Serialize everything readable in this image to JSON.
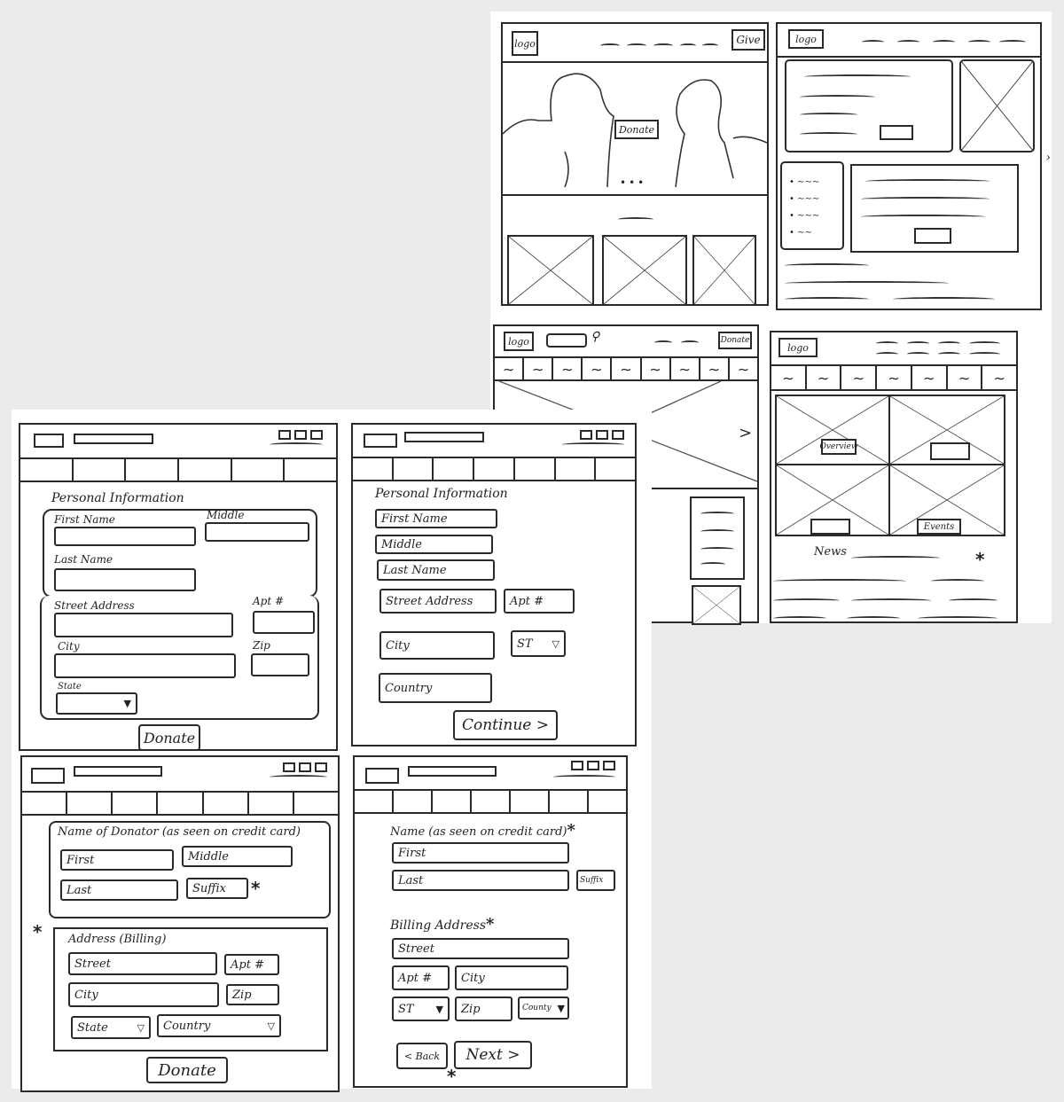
{
  "wireframes": {
    "home": {
      "logo": "logo",
      "give_button": "Give",
      "donate_button": "Donate",
      "carousel_dots": "•••"
    },
    "content_page": {
      "logo": "logo",
      "right_arrow": "›"
    },
    "search_page": {
      "logo": "logo",
      "search_icon": "⚲",
      "donate_button": "Donate",
      "next_arrow": ">"
    },
    "grid_page": {
      "logo": "logo",
      "tiles": [
        "Overview",
        "",
        "",
        "Events"
      ],
      "news_heading": "News",
      "asterisk": "*"
    },
    "form_a": {
      "section_title": "Personal Information",
      "labels": {
        "first": "First Name",
        "middle": "Middle",
        "last": "Last Name",
        "street": "Street Address",
        "apt": "Apt #",
        "city": "City",
        "zip": "Zip",
        "state": "State"
      },
      "state_dropdown_icon": "▼",
      "submit_button": "Donate"
    },
    "form_b": {
      "section_title": "Personal Information",
      "fields": {
        "first": "First Name",
        "middle": "Middle",
        "last": "Last Name",
        "street": "Street Address",
        "apt": "Apt #",
        "city": "City",
        "state": "ST",
        "country": "Country"
      },
      "state_dropdown_icon": "▽",
      "continue_button": "Continue >"
    },
    "form_c": {
      "name_section_title": "Name of Donator (as seen on credit card)",
      "fields": {
        "first": "First",
        "middle": "Middle",
        "last": "Last",
        "suffix": "Suffix",
        "street": "Street",
        "apt": "Apt #",
        "city": "City",
        "zip": "Zip",
        "state": "State",
        "country": "Country"
      },
      "address_section_title": "Address (Billing)",
      "dropdown_icon": "▽",
      "asterisk": "*",
      "submit_button": "Donate"
    },
    "form_d": {
      "name_section_title": "Name (as seen on credit card)",
      "fields": {
        "first": "First",
        "last": "Last",
        "suffix": "Suffix",
        "street": "Street",
        "apt": "Apt #",
        "city": "City",
        "state": "ST",
        "zip": "Zip",
        "county": "County"
      },
      "address_section_title": "Billing Address",
      "dropdown_icon": "▼",
      "asterisk": "*",
      "back_button": "< Back",
      "next_button": "Next >"
    }
  }
}
